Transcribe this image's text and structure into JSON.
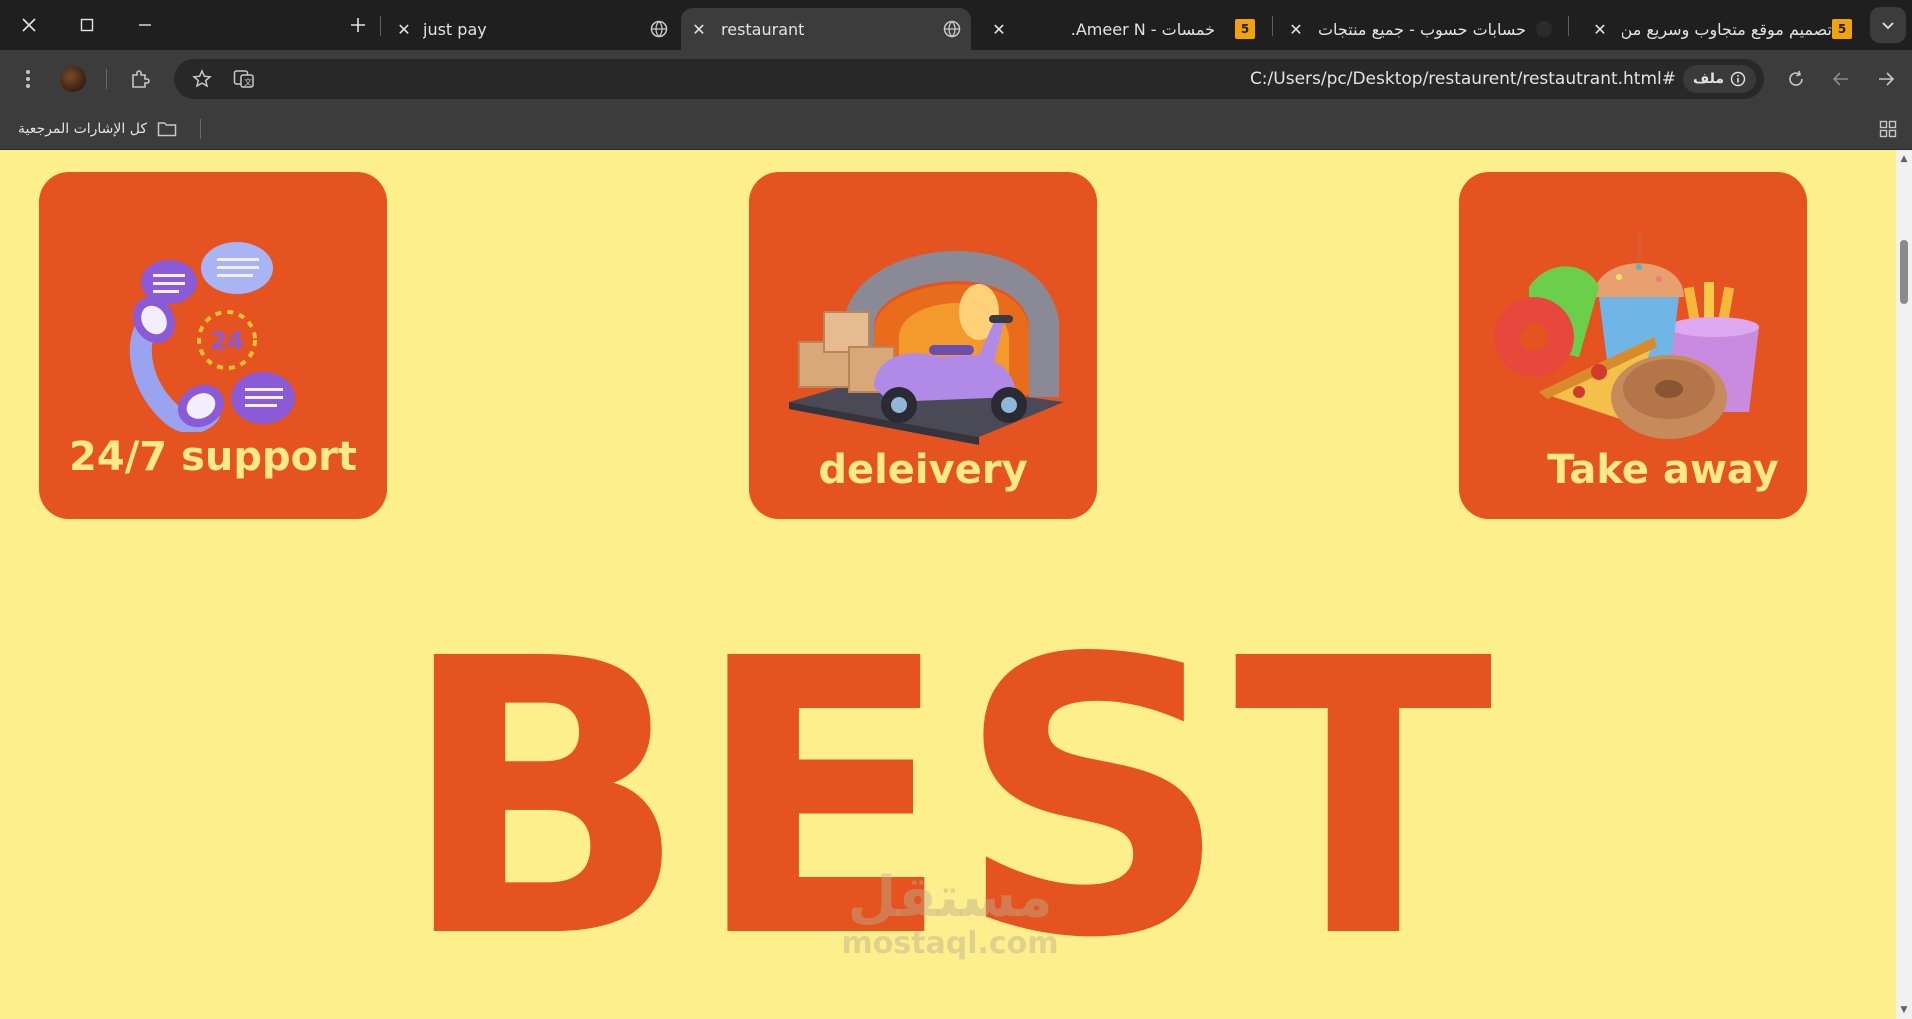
{
  "tabs": [
    {
      "title": "just pay",
      "active": false
    },
    {
      "title": "restaurant",
      "active": true
    },
    {
      "title": "خمسات - Ameer N.",
      "active": false
    },
    {
      "title": "حسابات حسوب - جميع منتجات حسوب",
      "active": false
    },
    {
      "title": "تصميم موقع متجاوب وسريع من البداية",
      "active": false
    }
  ],
  "tab_badge": "5",
  "address_bar": {
    "url": "C:/Users/pc/Desktop/restaurent/restautrant.html#",
    "chip_label": "ملف"
  },
  "bookmarks": {
    "all_label": "كل الإشارات المرجعية"
  },
  "cards": [
    {
      "label": "24/7 support",
      "icon": "support-24-7-icon"
    },
    {
      "label": "deleivery",
      "icon": "delivery-scooter-icon"
    },
    {
      "label": "Take away",
      "icon": "fast-food-icon"
    }
  ],
  "hero_text": "BEST",
  "watermark": {
    "arabic": "مستقل",
    "latin": "mostaql.com"
  },
  "colors": {
    "page_bg": "#fcef8c",
    "card_bg": "#e45320",
    "card_text": "#fbe98a",
    "chrome_bg": "#1f1f1f",
    "toolbar_bg": "#3c3c3c"
  }
}
